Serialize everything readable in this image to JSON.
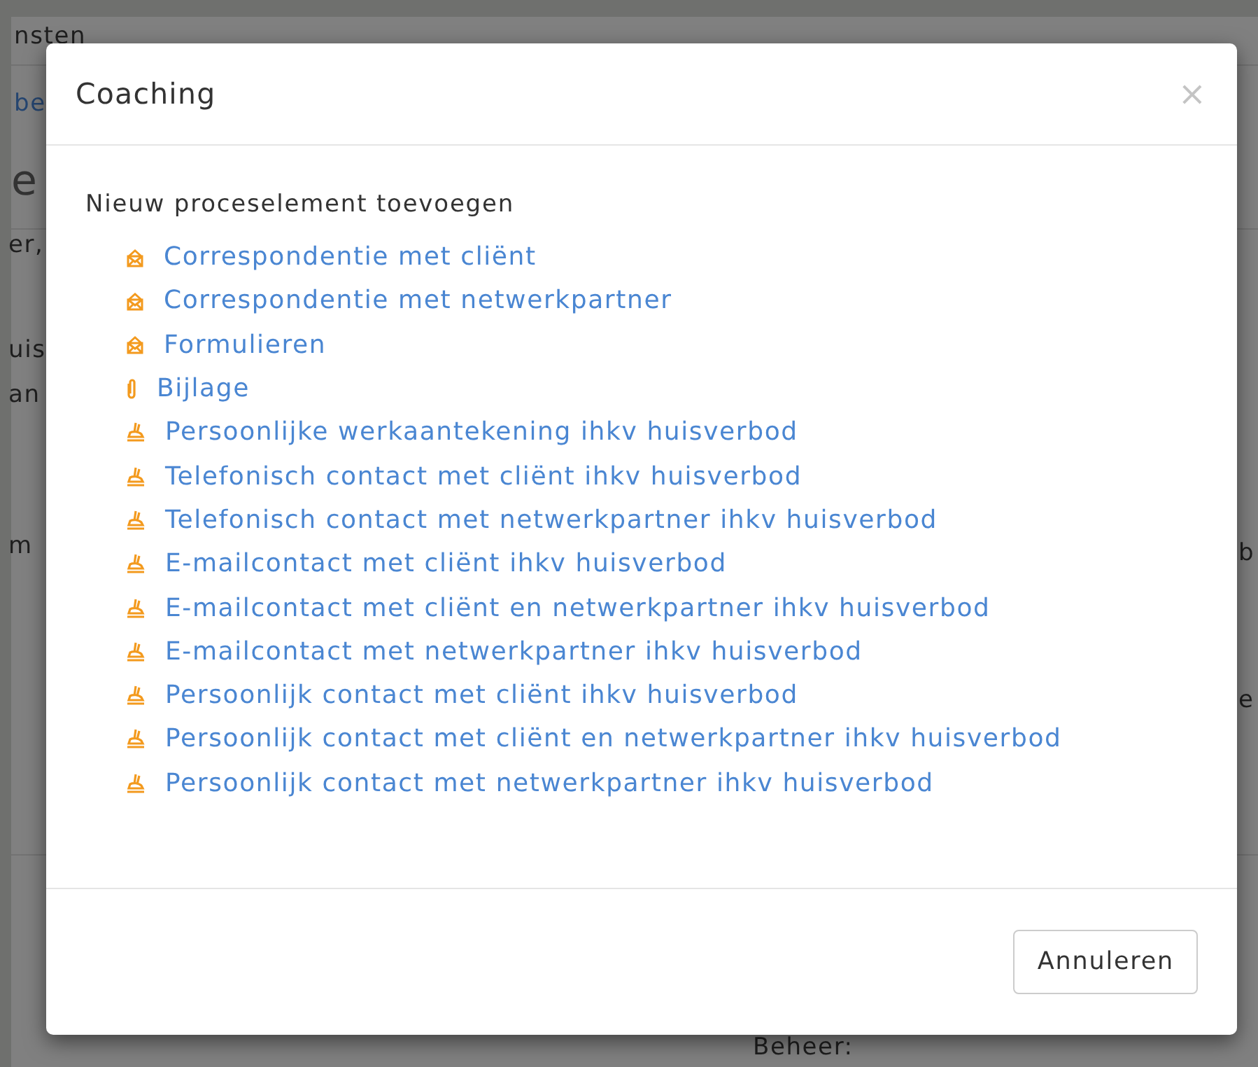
{
  "background_page": {
    "fragments": [
      {
        "text": "nsten",
        "kind": "text"
      },
      {
        "text": "be",
        "kind": "link"
      },
      {
        "text": "e",
        "kind": "heading"
      },
      {
        "text": "er,",
        "kind": "text"
      },
      {
        "text": "uis",
        "kind": "text"
      },
      {
        "text": "an",
        "kind": "text"
      },
      {
        "text": "m",
        "kind": "text"
      },
      {
        "text": "b",
        "kind": "text"
      },
      {
        "text": "e",
        "kind": "text"
      },
      {
        "text": "Beheer:",
        "kind": "text"
      }
    ]
  },
  "dialog": {
    "title": "Coaching",
    "close": "×",
    "heading": "Nieuw proceselement toevoegen",
    "items": [
      {
        "label": "Correspondentie met cliënt",
        "kind": "letter"
      },
      {
        "label": "Correspondentie met netwerkpartner",
        "kind": "letter"
      },
      {
        "label": "Formulieren",
        "kind": "letter"
      },
      {
        "label": "Bijlage",
        "kind": "attachment"
      },
      {
        "label": "Persoonlijke werkaantekening ihkv huisverbod",
        "kind": "note"
      },
      {
        "label": "Telefonisch contact met cliënt ihkv huisverbod",
        "kind": "note"
      },
      {
        "label": "Telefonisch contact met netwerkpartner ihkv huisverbod",
        "kind": "note"
      },
      {
        "label": "E-mailcontact met cliënt ihkv huisverbod",
        "kind": "note"
      },
      {
        "label": "E-mailcontact met cliënt en netwerkpartner ihkv huisverbod",
        "kind": "note"
      },
      {
        "label": "E-mailcontact met netwerkpartner ihkv huisverbod",
        "kind": "note"
      },
      {
        "label": "Persoonlijk contact met cliënt ihkv huisverbod",
        "kind": "note"
      },
      {
        "label": "Persoonlijk contact met cliënt en netwerkpartner ihkv huisverbod",
        "kind": "note"
      },
      {
        "label": "Persoonlijk contact met netwerkpartner ihkv huisverbod",
        "kind": "note"
      }
    ],
    "buttons": [
      "Annuleren"
    ]
  }
}
